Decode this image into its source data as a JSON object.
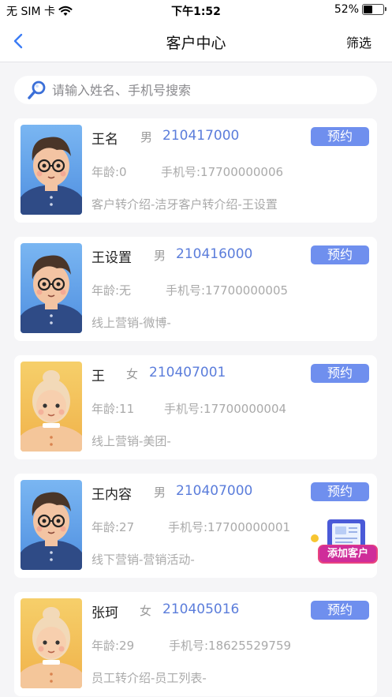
{
  "status_bar": {
    "carrier": "无 SIM 卡",
    "time": "下午1:52",
    "battery": "52%",
    "battery_level": 0.52
  },
  "nav": {
    "title": "客户中心",
    "filter_label": "筛选"
  },
  "search": {
    "placeholder": "请输入姓名、手机号搜索"
  },
  "customers": [
    {
      "name": "王名",
      "gender": "男",
      "id": "210417000",
      "age": "年龄:0",
      "phone": "手机号:17700000006",
      "source": "客户转介绍-洁牙客户转介绍-王设置",
      "button": "预约"
    },
    {
      "name": "王设置",
      "gender": "男",
      "id": "210416000",
      "age": "年龄:无",
      "phone": "手机号:17700000005",
      "source": "线上营销-微博-",
      "button": "预约"
    },
    {
      "name": "王",
      "gender": "女",
      "id": "210407001",
      "age": "年龄:11",
      "phone": "手机号:17700000004",
      "source": "线上营销-美团-",
      "button": "预约"
    },
    {
      "name": "王内容",
      "gender": "男",
      "id": "210407000",
      "age": "年龄:27",
      "phone": "手机号:17700000001",
      "source": "线下营销-营销活动-",
      "button": "预约"
    },
    {
      "name": "张珂",
      "gender": "女",
      "id": "210405016",
      "age": "年龄:29",
      "phone": "手机号:18625529759",
      "source": "员工转介绍-员工列表-",
      "button": "预约"
    }
  ],
  "add_customer": {
    "label": "添加客户"
  },
  "colors": {
    "accent": "#6f8fee",
    "id_text": "#5b7ddb"
  }
}
